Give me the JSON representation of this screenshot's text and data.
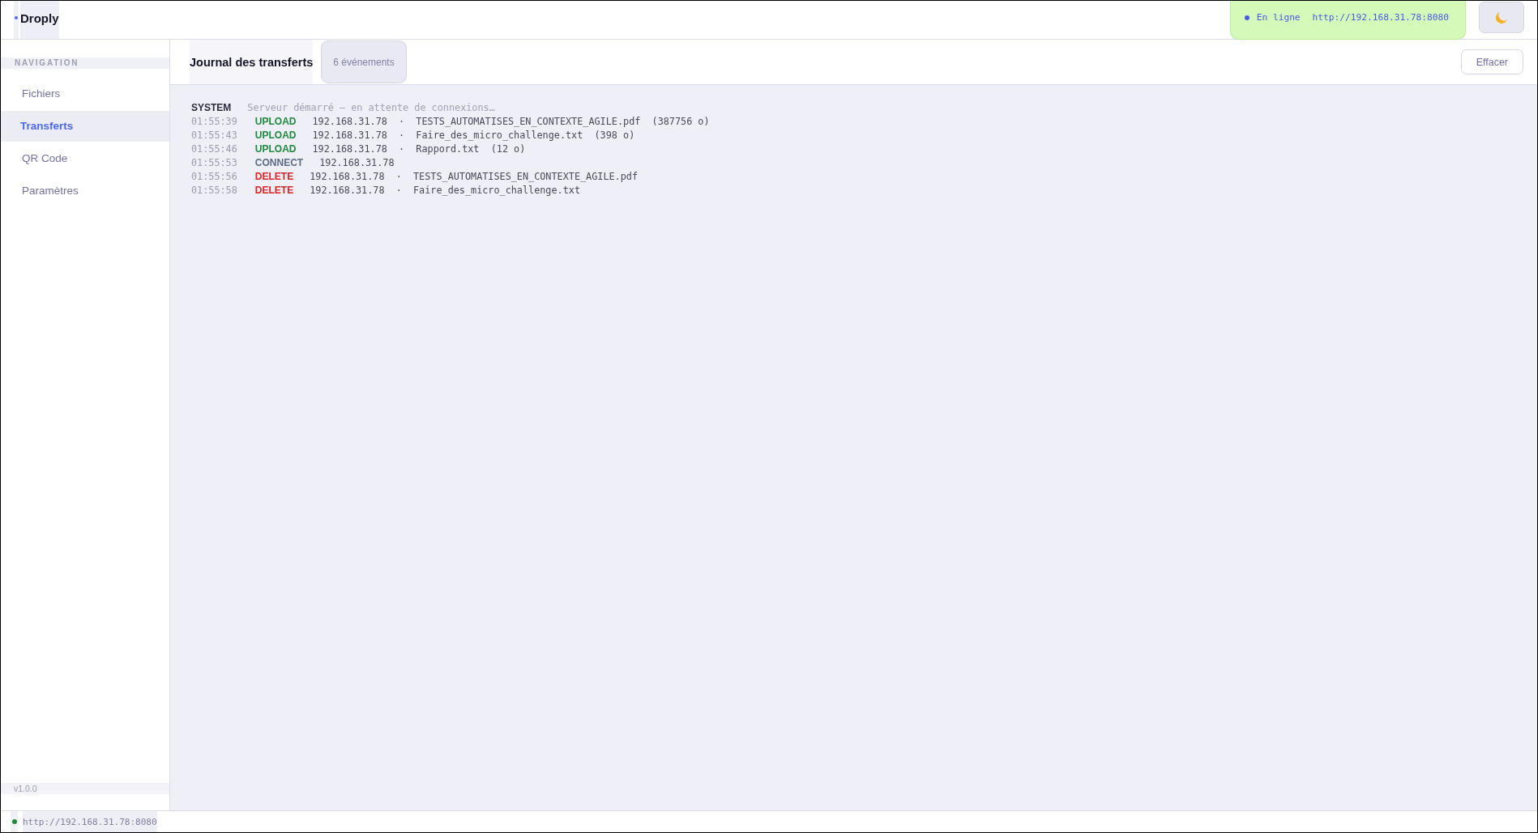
{
  "header": {
    "app_name": "Droply",
    "status": {
      "online": true,
      "label": "En ligne",
      "url": "http://192.168.31.78:8080"
    }
  },
  "sidebar": {
    "section_title": "NAVIGATION",
    "items": [
      {
        "label": "Fichiers",
        "selected": false
      },
      {
        "label": "Transferts",
        "selected": true
      },
      {
        "label": "QR Code",
        "selected": false
      },
      {
        "label": "Paramètres",
        "selected": false
      }
    ],
    "version": "v1.0.0"
  },
  "journal": {
    "title": "Journal des transferts",
    "count": "6 événements",
    "clear_button": "Effacer",
    "entries": [
      {
        "kind": "system",
        "type": "SYSTEM",
        "color": "#2c2c3e",
        "message": "Serveur démarré — en attente de connexions…"
      },
      {
        "kind": "event",
        "time": "01:55:39",
        "type": "UPLOAD",
        "color": "#1e8a3c",
        "message": "192.168.31.78  ·  TESTS_AUTOMATISES_EN_CONTEXTE_AGILE.pdf  (387756 o)"
      },
      {
        "kind": "event",
        "time": "01:55:43",
        "type": "UPLOAD",
        "color": "#1e8a3c",
        "message": "192.168.31.78  ·  Faire_des_micro_challenge.txt  (398 o)"
      },
      {
        "kind": "event",
        "time": "01:55:46",
        "type": "UPLOAD",
        "color": "#1e8a3c",
        "message": "192.168.31.78  ·  Rappord.txt  (12 o)"
      },
      {
        "kind": "event",
        "time": "01:55:53",
        "type": "CONNECT",
        "color": "#5c6c84",
        "message": "192.168.31.78"
      },
      {
        "kind": "event",
        "time": "01:55:56",
        "type": "DELETE",
        "color": "#e02424",
        "message": "192.168.31.78  ·  TESTS_AUTOMATISES_EN_CONTEXTE_AGILE.pdf"
      },
      {
        "kind": "event",
        "time": "01:55:58",
        "type": "DELETE",
        "color": "#e02424",
        "message": "192.168.31.78  ·  Faire_des_micro_challenge.txt"
      }
    ]
  },
  "footer": {
    "url": "http://192.168.31.78:8080"
  }
}
